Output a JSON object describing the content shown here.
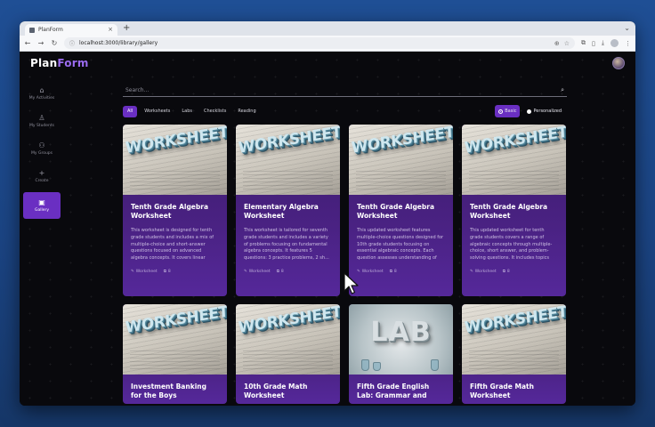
{
  "browser": {
    "tab_title": "PlanForm",
    "tab_close": "×",
    "new_tab": "+",
    "url": "localhost:3000/library/gallery",
    "url_prefix_icon": "ⓘ"
  },
  "app": {
    "logo_part1": "Plan",
    "logo_part2": "Form",
    "accent": "#6a2fc2",
    "logo_accent": "#9b6cf0"
  },
  "sidebar": {
    "items": [
      {
        "label": "My Activities",
        "icon": "home-icon"
      },
      {
        "label": "My Students",
        "icon": "person-icon"
      },
      {
        "label": "My Groups",
        "icon": "group-icon"
      },
      {
        "label": "Create",
        "icon": "plus-icon"
      },
      {
        "label": "Gallery",
        "icon": "gallery-icon"
      }
    ],
    "active": "Gallery"
  },
  "search": {
    "placeholder": "Search..."
  },
  "filters": {
    "chips": [
      "All",
      "Worksheets",
      "Labs",
      "Checklists",
      "Reading"
    ],
    "active_chip": "All",
    "toggles": [
      "Basic",
      "Personalized"
    ],
    "active_toggle": "Basic"
  },
  "cards": [
    {
      "thumb_text": "WORKSHEET",
      "title": "Tenth Grade Algebra Worksheet",
      "description": "This worksheet is designed for tenth grade students and includes a mix of multiple-choice and short-answer questions focused on advanced algebra concepts. It covers linear equations, qu...",
      "author": "Worksheet",
      "count": "8"
    },
    {
      "thumb_text": "WORKSHEET",
      "title": "Elementary Algebra Worksheet",
      "description": "This worksheet is tailored for seventh grade students and includes a variety of problems focusing on fundamental algebra concepts. It features 5 questions: 3 practice problems, 2 sh...",
      "author": "Worksheet",
      "count": "8"
    },
    {
      "thumb_text": "WORKSHEET",
      "title": "Tenth Grade Algebra Worksheet",
      "description": "This updated worksheet features multiple-choice questions designed for 10th grade students focusing on essential algebraic concepts. Each question assesses understanding of algebr...",
      "author": "Worksheet",
      "count": "8"
    },
    {
      "thumb_text": "WORKSHEET",
      "title": "Tenth Grade Algebra Worksheet",
      "description": "This updated worksheet for tenth grade students covers a range of algebraic concepts through multiple-choice, short answer, and problem-solving questions. It includes topics such as so...",
      "author": "Worksheet",
      "count": "8"
    },
    {
      "thumb_text": "WORKSHEET",
      "title": "Investment Banking for the Boys"
    },
    {
      "thumb_text": "WORKSHEET",
      "title": "10th Grade Math Worksheet"
    },
    {
      "thumb_text": "LAB",
      "title": "Fifth Grade English Lab: Grammar and"
    },
    {
      "thumb_text": "WORKSHEET",
      "title": "Fifth Grade Math Worksheet"
    }
  ]
}
